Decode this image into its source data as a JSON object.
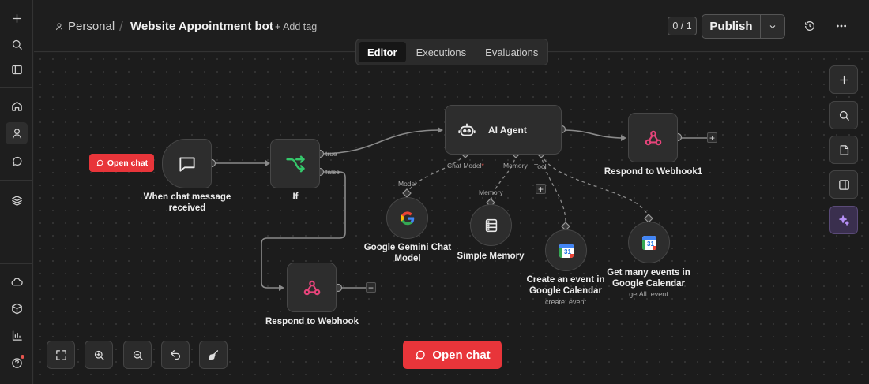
{
  "header": {
    "breadcrumb_personal": "Personal",
    "workflow_title": "Website Appointment bot",
    "add_tag": "+ Add tag",
    "counter": "0 / 1",
    "publish_label": "Publish"
  },
  "tabs": [
    {
      "label": "Editor",
      "active": true
    },
    {
      "label": "Executions",
      "active": false
    },
    {
      "label": "Evaluations",
      "active": false
    }
  ],
  "rail": {
    "icons": [
      "plus-icon",
      "search-icon",
      "sidebar-toggle-icon",
      "home-icon",
      "user-icon",
      "chat-icon",
      "layers-icon",
      "cloud-icon",
      "cube-icon",
      "bar-chart-icon",
      "help-icon"
    ]
  },
  "canvas": {
    "chip_open_chat": "Open chat",
    "nodes": {
      "trigger": {
        "label": "When chat message received"
      },
      "if": {
        "label": "If",
        "true_label": "true",
        "false_label": "false"
      },
      "agent": {
        "label": "AI Agent",
        "port_chat_model": "Chat Model",
        "port_required": "*",
        "port_memory": "Memory",
        "port_tool": "Tool"
      },
      "respond1": {
        "label": "Respond to Webhook1"
      },
      "respond": {
        "label": "Respond to Webhook"
      },
      "gemini": {
        "label": "Google Gemini Chat Model",
        "port": "Model"
      },
      "memory": {
        "label": "Simple Memory",
        "port": "Memory"
      },
      "create_event": {
        "label": "Create an event in Google Calendar",
        "sub": "create: event"
      },
      "get_events": {
        "label": "Get many events in Google Calendar",
        "sub": "getAll: event"
      }
    },
    "calendar_day": "31",
    "plus": "+"
  },
  "bottom": {
    "open_chat": "Open chat"
  },
  "colors": {
    "accent_red": "#e8353a",
    "webhook_pink": "#e5447a",
    "if_green": "#35c76b",
    "ai_purple": "#a67cf0"
  }
}
